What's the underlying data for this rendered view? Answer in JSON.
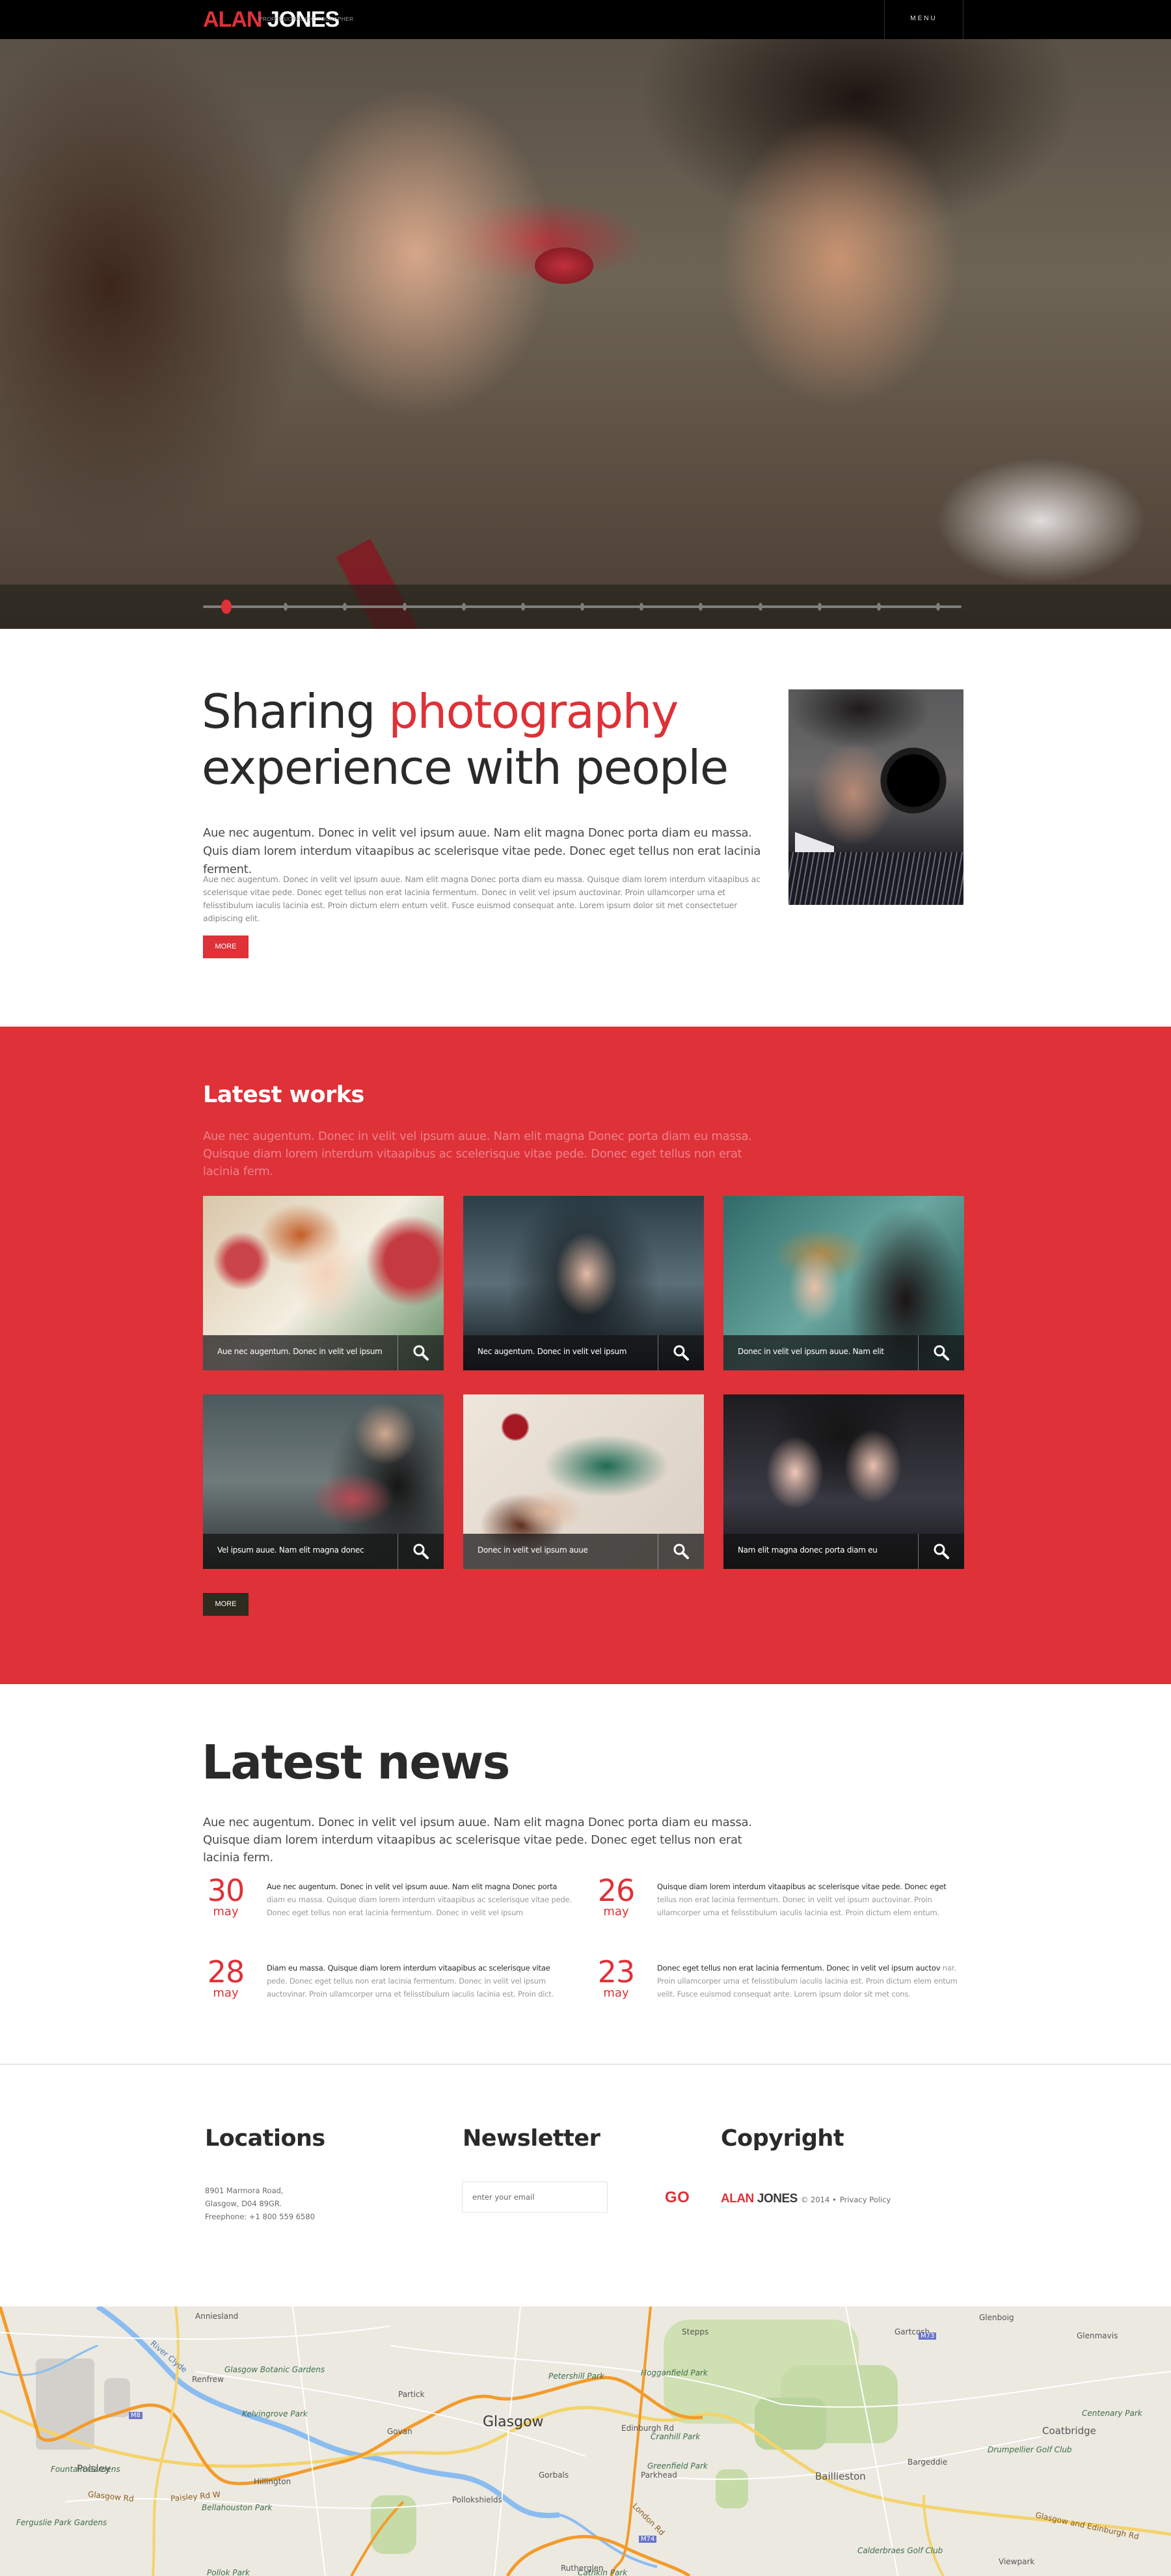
{
  "header": {
    "logo_first": "ALAN",
    "logo_last": "JONES",
    "tagline": "PROFESSIONAL PHOTOGRAPHER",
    "menu_label": "MENU"
  },
  "hero": {
    "slide_count": 13,
    "active_slide": 1
  },
  "intro": {
    "title_part1": "Sharing ",
    "title_accent": "photography",
    "title_part2": "experience with people",
    "lead": "Aue nec augentum. Donec in velit vel ipsum auue. Nam elit magna Donec porta diam eu massa. Quis diam lorem interdum vitaapibus ac scelerisque vitae pede. Donec eget tellus non erat lacinia ferment.",
    "body": "Aue nec augentum. Donec in velit vel ipsum auue. Nam elit magna Donec porta diam eu massa. Quisque diam lorem interdum vitaapibus ac scelerisque vitae pede. Donec eget tellus non erat lacinia fermentum.  Donec in velit vel ipsum auctovinar. Proin ullamcorper urna et felisstibulum iaculis lacinia est. Proin dictum elem entum velit. Fusce euismod consequat ante. Lorem ipsum dolor sit met consectetuer adipiscing elit.",
    "more_label": "MORE"
  },
  "works": {
    "title": "Latest works",
    "description": "Aue nec augentum. Donec in velit vel ipsum auue. Nam elit magna Donec porta diam eu massa. Quisque diam lorem interdum vitaapibus ac scelerisque vitae pede. Donec eget tellus non erat lacinia ferm.",
    "items": [
      {
        "caption": "Aue nec augentum. Donec in velit vel ipsum"
      },
      {
        "caption": "Nec augentum. Donec in velit vel ipsum"
      },
      {
        "caption": "Donec in velit vel ipsum auue. Nam elit"
      },
      {
        "caption": "Vel ipsum auue. Nam elit magna donec"
      },
      {
        "caption": "Donec in velit vel ipsum auue"
      },
      {
        "caption": "Nam elit magna donec porta diam eu"
      }
    ],
    "more_label": "MORE"
  },
  "news": {
    "title": "Latest news",
    "description": "Aue nec augentum. Donec in velit vel ipsum auue. Nam elit magna Donec porta diam eu massa. Quisque diam lorem interdum vitaapibus ac scelerisque vitae pede. Donec eget tellus non erat lacinia ferm.",
    "items": [
      {
        "day": "30",
        "month": "may",
        "lead": "Aue nec augentum. Donec in velit vel ipsum auue. Nam elit magna Donec porta",
        "text": " diam eu massa. Quisque diam lorem interdum vitaapibus ac scelerisque vitae pede. Donec eget tellus non erat lacinia fermentum.  Donec in velit vel ipsum"
      },
      {
        "day": "26",
        "month": "may",
        "lead": "Quisque diam lorem interdum vitaapibus ac scelerisque vitae pede. Donec eget",
        "text": " tellus non erat lacinia fermentum.  Donec in velit vel ipsum auctovinar. Proin ullamcorper urna et felisstibulum iaculis lacinia est. Proin dictum elem entum."
      },
      {
        "day": "28",
        "month": "may",
        "lead": "Diam eu massa. Quisque diam lorem interdum vitaapibus ac scelerisque vitae",
        "text": " pede. Donec eget tellus non erat lacinia fermentum.  Donec in velit vel ipsum auctovinar. Proin ullamcorper urna et felisstibulum iaculis lacinia est. Proin dict."
      },
      {
        "day": "23",
        "month": "may",
        "lead": "Donec eget tellus non erat lacinia fermentum.  Donec in velit vel ipsum auctov",
        "text": " nar. Proin ullamcorper urna et felisstibulum iaculis lacinia est. Proin dictum elem entum velit. Fusce euismod consequat ante. Lorem ipsum dolor sit met cons."
      }
    ]
  },
  "footer": {
    "locations": {
      "title": "Locations",
      "address_line1": "8901 Marmora Road,",
      "address_line2": "Glasgow, D04 89GR.",
      "phone": "Freephone: +1 800 559 6580"
    },
    "newsletter": {
      "title": "Newsletter",
      "placeholder": "enter your email",
      "value": "",
      "go_label": "GO"
    },
    "copyright": {
      "title": "Copyright",
      "brand_first": "ALAN",
      "brand_last": "JONES",
      "year_text": "© 2014 •",
      "privacy_label": "Privacy Policy"
    }
  },
  "map": {
    "labels": {
      "glasgow": "Glasgow",
      "paisley": "Paisley",
      "renfrew": "Renfrew",
      "govan": "Govan",
      "partick": "Partick",
      "hillington": "Hillington",
      "pollokshields": "Pollokshields",
      "gorbals": "Gorbals",
      "baillieston": "Baillieston",
      "coatbridge": "Coatbridge",
      "bargeddie": "Bargeddie",
      "parkhead": "Parkhead",
      "stepps": "Stepps",
      "gartcosh": "Gartcosh",
      "glenboig": "Glenboig",
      "glenmavis": "Glenmavis",
      "viewpark": "Viewpark",
      "rutherglen": "Rutherglen",
      "anniesland": "Anniesland",
      "botanic": "Glasgow Botanic Gardens",
      "kelvingrove": "Kelvingrove Park",
      "bellahouston": "Bellahouston Park",
      "pollok": "Pollok Park",
      "fountain": "Fountain Gardens",
      "ferguslie": "Ferguslie Park Gardens",
      "hogganfield": "Hogganfield Park",
      "cranhill": "Cranhill Park",
      "greenfield": "Greenfield Park",
      "drumpellier": "Drumpellier Golf Club",
      "centenary": "Centenary Park",
      "calderbraes": "Calderbraes Golf Club",
      "cathkin": "Cathkin Park",
      "petershill": "Petershill Park",
      "river_clyde": "River Clyde",
      "paisley_rd": "Paisley Rd W",
      "glasgow_rd": "Glasgow Rd",
      "edinburgh_rd": "Edinburgh Rd",
      "glasgow_edinburgh_rd": "Glasgow and Edinburgh Rd",
      "london_rd": "London Rd",
      "m8": "M8",
      "m73": "M73",
      "m74": "M74"
    }
  },
  "colors": {
    "accent": "#de3138",
    "dark": "#2a2a2a",
    "header_bg": "#000000",
    "works_bg": "#de3138",
    "dark_button": "#2e2b1f"
  }
}
